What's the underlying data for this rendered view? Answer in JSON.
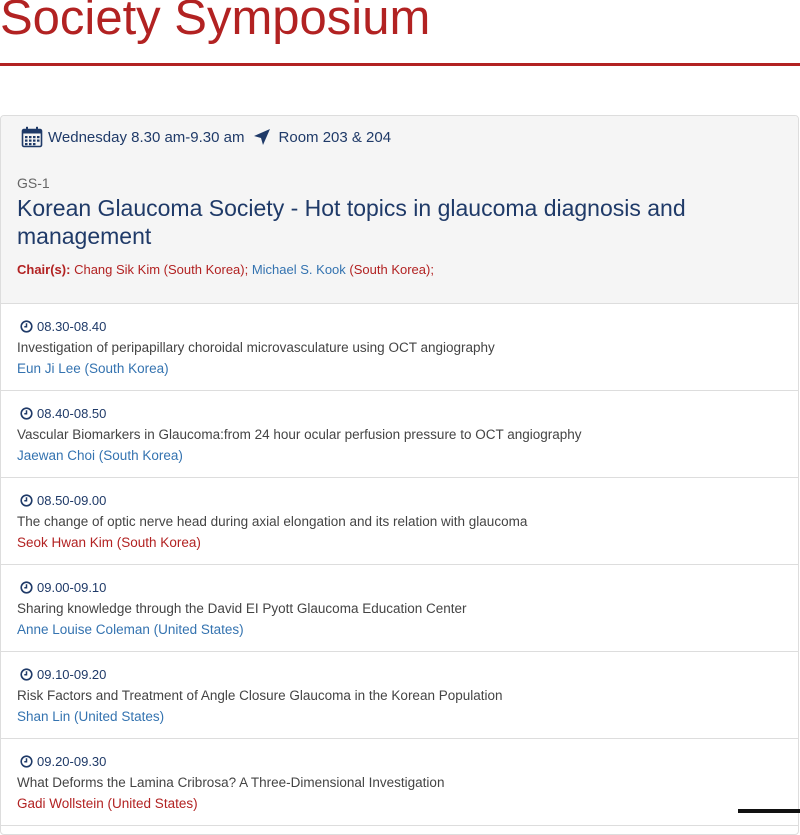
{
  "page": {
    "title": "Society Symposium"
  },
  "session": {
    "day_time": "Wednesday 8.30 am-9.30 am",
    "room": "Room 203 & 204",
    "code": "GS-1",
    "title": "Korean Glaucoma Society - Hot topics in glaucoma diagnosis and management",
    "chairs_label": "Chair(s):",
    "chairs": [
      {
        "name": "Chang Sik Kim (South Korea);",
        "color": "#b22222"
      },
      {
        "name": "Michael S. Kook",
        "color": "#3473b0"
      },
      {
        "name": "(South Korea);",
        "color": "#b22222"
      }
    ]
  },
  "talks": [
    {
      "time": "08.30-08.40",
      "title": "Investigation of peripapillary choroidal microvasculature using OCT angiography",
      "speaker": "Eun Ji Lee (South Korea)",
      "speaker_color": "#3473b0"
    },
    {
      "time": "08.40-08.50",
      "title": "Vascular Biomarkers in Glaucoma:from 24 hour ocular perfusion pressure to OCT angiography",
      "speaker": "Jaewan Choi (South Korea)",
      "speaker_color": "#3473b0"
    },
    {
      "time": "08.50-09.00",
      "title": "The change of optic nerve head during axial elongation and its relation with glaucoma",
      "speaker": "Seok Hwan Kim (South Korea)",
      "speaker_color": "#b22222"
    },
    {
      "time": "09.00-09.10",
      "title": "Sharing knowledge through the David EI Pyott Glaucoma Education Center",
      "speaker": "Anne Louise Coleman (United States)",
      "speaker_color": "#3473b0"
    },
    {
      "time": "09.10-09.20",
      "title": "Risk Factors and Treatment of Angle Closure Glaucoma in the Korean Population",
      "speaker": "Shan Lin (United States)",
      "speaker_color": "#3473b0"
    },
    {
      "time": "09.20-09.30",
      "title": "What Deforms the Lamina Cribrosa? A Three-Dimensional Investigation",
      "speaker": "Gadi Wollstein (United States)",
      "speaker_color": "#b22222"
    }
  ],
  "icons": {
    "calendar": "calendar-icon",
    "location": "location-arrow-icon",
    "clock": "clock-icon"
  }
}
